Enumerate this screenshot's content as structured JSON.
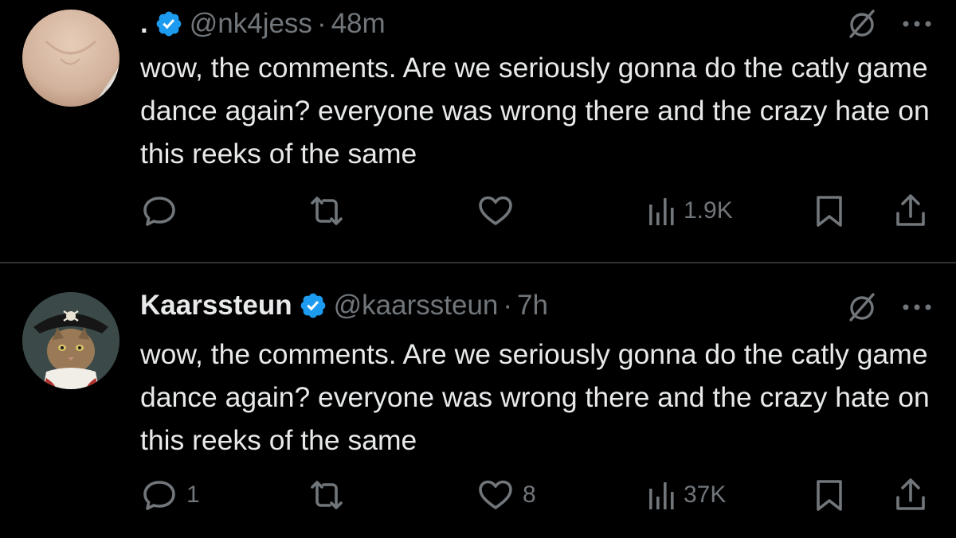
{
  "colors": {
    "background": "#000000",
    "text": "#e7e9ea",
    "secondary": "#71767b",
    "verified": "#1d9bf0",
    "divider": "#2f3336"
  },
  "tweets": [
    {
      "display_name": ".",
      "handle": "@nk4jess",
      "separator": "·",
      "time": "48m",
      "text": "wow, the comments. Are we seriously gonna do the catly game dance again? everyone was wrong there and the crazy hate on this reeks of the same",
      "replies": "",
      "retweets": "",
      "likes": "",
      "views": "1.9K",
      "icons": [
        "grok-icon",
        "more-icon",
        "reply-icon",
        "retweet-icon",
        "like-icon",
        "views-icon",
        "bookmark-icon",
        "share-icon"
      ]
    },
    {
      "display_name": "Kaarssteun",
      "handle": "@kaarssteun",
      "separator": "·",
      "time": "7h",
      "text": "wow, the comments. Are we seriously gonna do the catly game dance again? everyone was wrong there and the crazy hate on this reeks of the same",
      "replies": "1",
      "retweets": "",
      "likes": "8",
      "views": "37K",
      "icons": [
        "grok-icon",
        "more-icon",
        "reply-icon",
        "retweet-icon",
        "like-icon",
        "views-icon",
        "bookmark-icon",
        "share-icon"
      ]
    }
  ]
}
